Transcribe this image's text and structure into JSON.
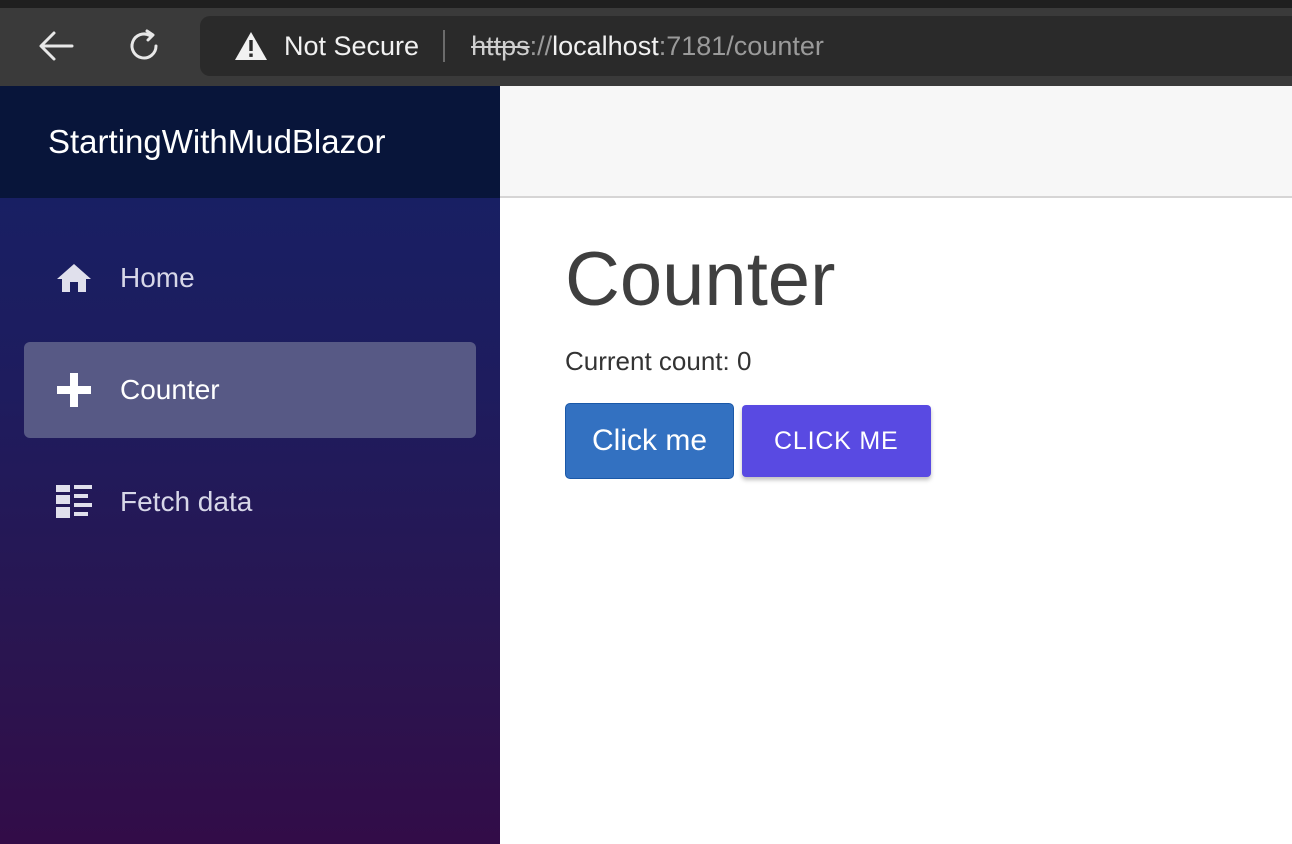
{
  "browser": {
    "security_label": "Not Secure",
    "url_scheme": "https",
    "url_sep": "://",
    "url_host": "localhost",
    "url_rest": ":7181/counter"
  },
  "sidebar": {
    "brand": "StartingWithMudBlazor",
    "items": [
      {
        "label": "Home",
        "icon": "home-icon",
        "active": false
      },
      {
        "label": "Counter",
        "icon": "plus-icon",
        "active": true
      },
      {
        "label": "Fetch data",
        "icon": "list-icon",
        "active": false
      }
    ]
  },
  "main": {
    "title": "Counter",
    "count_text": "Current count: 0",
    "button_primary": "Click me",
    "button_mud": "Click me"
  },
  "colors": {
    "sidebar_brand_bg": "#08153a",
    "active_item_bg": "#575985",
    "bootstrap_button": "#3371c1",
    "mud_button": "#594ae2"
  }
}
